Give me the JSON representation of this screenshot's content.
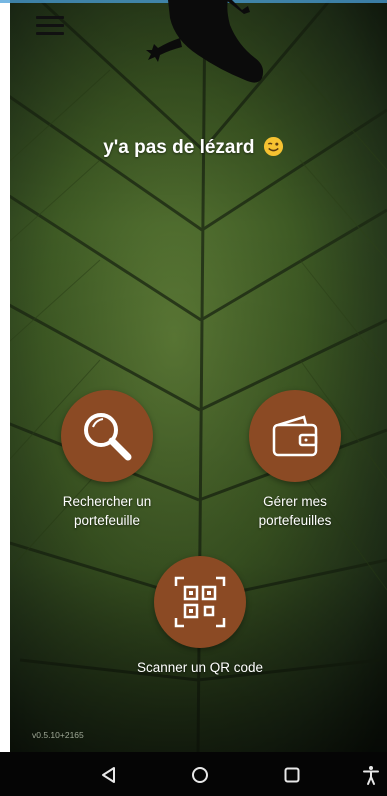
{
  "menu": {
    "icon": "hamburger-menu-icon"
  },
  "header": {
    "tagline": "y'a pas de lézard",
    "tagline_emoji": "winking-face-emoji"
  },
  "actions": [
    {
      "label": "Rechercher un portefeuille",
      "icon": "magnifier-icon"
    },
    {
      "label": "Gérer mes portefeuilles",
      "icon": "wallet-icon"
    },
    {
      "label": "Scanner un QR code",
      "icon": "qr-code-icon"
    }
  ],
  "footer": {
    "version": "v0.5.10+2165"
  },
  "system_nav": {
    "back": "back-triangle-icon",
    "home": "home-circle-icon",
    "recents": "recents-square-icon",
    "accessibility": "accessibility-icon"
  },
  "colors": {
    "accent": "#8b4a24",
    "leaf": "#3d5a22",
    "navbar": "#050505"
  }
}
